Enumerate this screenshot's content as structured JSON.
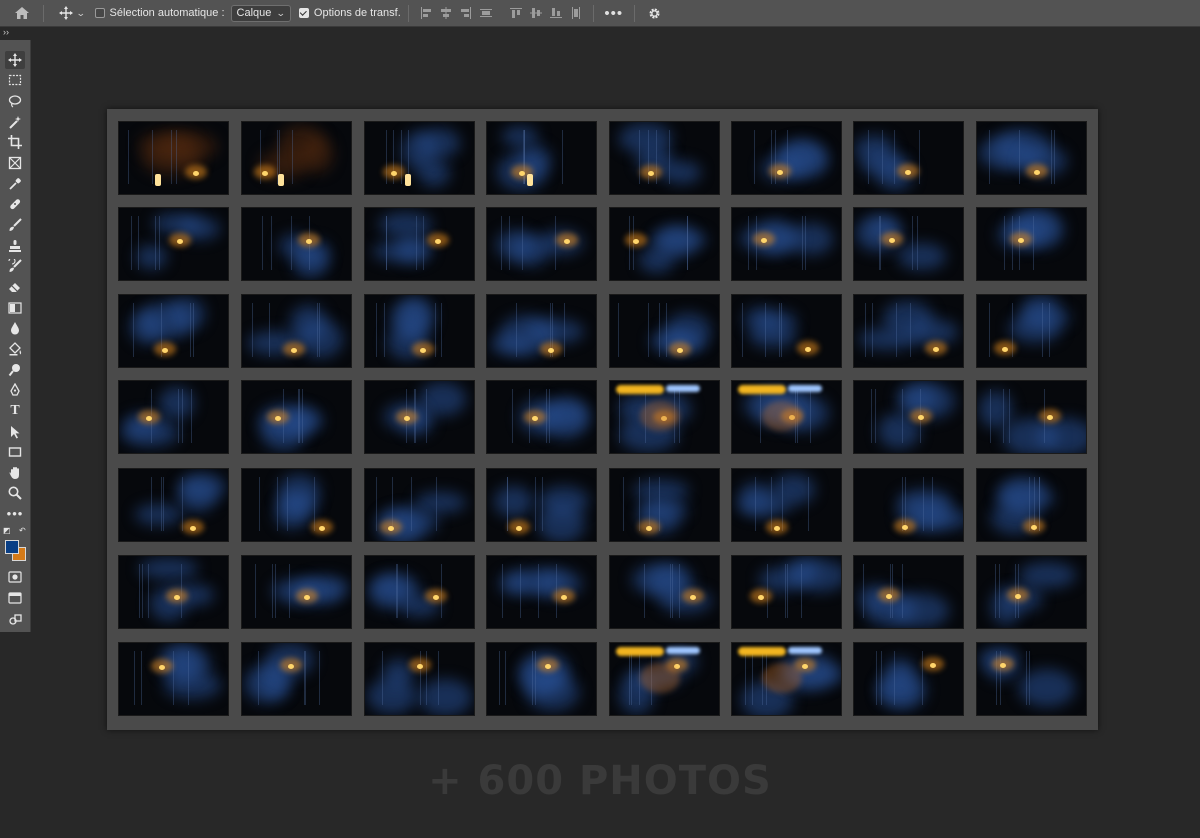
{
  "options_bar": {
    "auto_select_label": "Sélection automatique :",
    "auto_select_checked": false,
    "layer_dropdown_value": "Calque",
    "transform_options_label": "Options de transf.",
    "transform_options_checked": true,
    "more_label": "•••",
    "align_icons": [
      "align-left-icon",
      "align-center-h-icon",
      "align-right-icon",
      "distribute-h-icon",
      "align-top-icon",
      "align-middle-v-icon",
      "align-bottom-icon",
      "distribute-v-icon"
    ]
  },
  "tools_panel": {
    "collapse_label": "››",
    "type_tool_label": "T",
    "more_tools_label": "•••",
    "tools": [
      {
        "name": "move-tool-icon",
        "active": true
      },
      {
        "name": "rectangular-marquee-tool-icon"
      },
      {
        "name": "lasso-tool-icon"
      },
      {
        "name": "magic-wand-tool-icon"
      },
      {
        "name": "crop-tool-icon"
      },
      {
        "name": "frame-tool-icon"
      },
      {
        "name": "eyedropper-tool-icon"
      },
      {
        "name": "healing-brush-tool-icon"
      },
      {
        "name": "brush-tool-icon"
      },
      {
        "name": "clone-stamp-tool-icon"
      },
      {
        "name": "history-brush-tool-icon"
      },
      {
        "name": "eraser-tool-icon"
      },
      {
        "name": "gradient-tool-icon"
      },
      {
        "name": "blur-tool-icon"
      },
      {
        "name": "paint-bucket-tool-icon"
      },
      {
        "name": "dodge-tool-icon"
      },
      {
        "name": "pen-tool-icon"
      },
      {
        "name": "type-tool-icon"
      },
      {
        "name": "path-selection-tool-icon"
      },
      {
        "name": "rectangle-tool-icon"
      },
      {
        "name": "hand-tool-icon"
      },
      {
        "name": "zoom-tool-icon"
      },
      {
        "name": "edit-toolbar-icon"
      }
    ],
    "foreground_color": "#0a3f85",
    "background_color": "#d47a18"
  },
  "contact_sheet": {
    "rows": 7,
    "columns": 8,
    "thumbnail_subject": "long-exposure night light-painting photos"
  },
  "overlay_text": "+ 600 PHOTOS"
}
